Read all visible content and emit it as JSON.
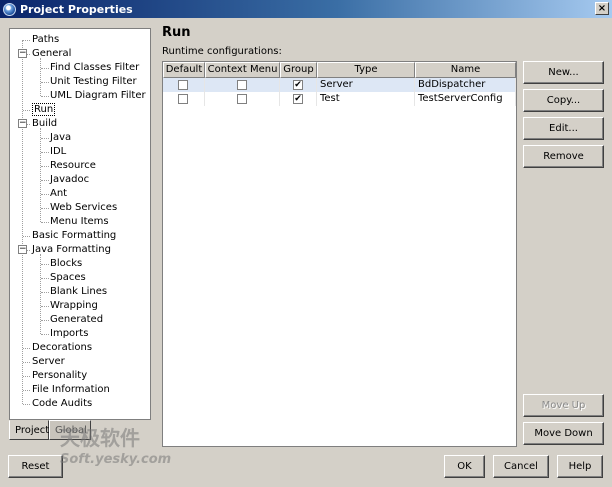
{
  "window": {
    "title": "Project Properties",
    "close_glyph": "×"
  },
  "tree": {
    "items": [
      {
        "label": "Paths"
      },
      {
        "label": "General",
        "expander": "⊟"
      },
      {
        "label": "Find Classes Filter"
      },
      {
        "label": "Unit Testing Filter"
      },
      {
        "label": "UML Diagram Filter"
      },
      {
        "label": "Run",
        "selected": true
      },
      {
        "label": "Build",
        "expander": "⊟"
      },
      {
        "label": "Java"
      },
      {
        "label": "IDL"
      },
      {
        "label": "Resource"
      },
      {
        "label": "Javadoc"
      },
      {
        "label": "Ant"
      },
      {
        "label": "Web Services"
      },
      {
        "label": "Menu Items"
      },
      {
        "label": "Basic Formatting"
      },
      {
        "label": "Java Formatting",
        "expander": "⊟"
      },
      {
        "label": "Blocks"
      },
      {
        "label": "Spaces"
      },
      {
        "label": "Blank Lines"
      },
      {
        "label": "Wrapping"
      },
      {
        "label": "Generated"
      },
      {
        "label": "Imports"
      },
      {
        "label": "Decorations"
      },
      {
        "label": "Server"
      },
      {
        "label": "Personality"
      },
      {
        "label": "File Information"
      },
      {
        "label": "Code Audits"
      }
    ],
    "tabs": [
      {
        "label": "Project",
        "active": true
      },
      {
        "label": "Global",
        "active": false
      }
    ]
  },
  "main": {
    "title": "Run",
    "subtitle": "Runtime configurations:",
    "table": {
      "columns": [
        "Default",
        "Context Menu",
        "Group",
        "Type",
        "Name"
      ],
      "rows": [
        {
          "default": false,
          "context_menu": false,
          "group": true,
          "type": "Server",
          "name": "BdDispatcher",
          "selected": true
        },
        {
          "default": false,
          "context_menu": false,
          "group": true,
          "type": "Test",
          "name": "TestServerConfig",
          "selected": false
        }
      ]
    },
    "buttons": {
      "new": "New...",
      "copy": "Copy...",
      "edit": "Edit...",
      "remove": "Remove",
      "move_up": "Move Up",
      "move_down": "Move Down"
    }
  },
  "footer": {
    "reset": "Reset",
    "ok": "OK",
    "cancel": "Cancel",
    "help": "Help"
  },
  "watermark": {
    "line1": "天极软件",
    "line2": "Soft.yesky.com"
  },
  "check_glyph": "✔"
}
